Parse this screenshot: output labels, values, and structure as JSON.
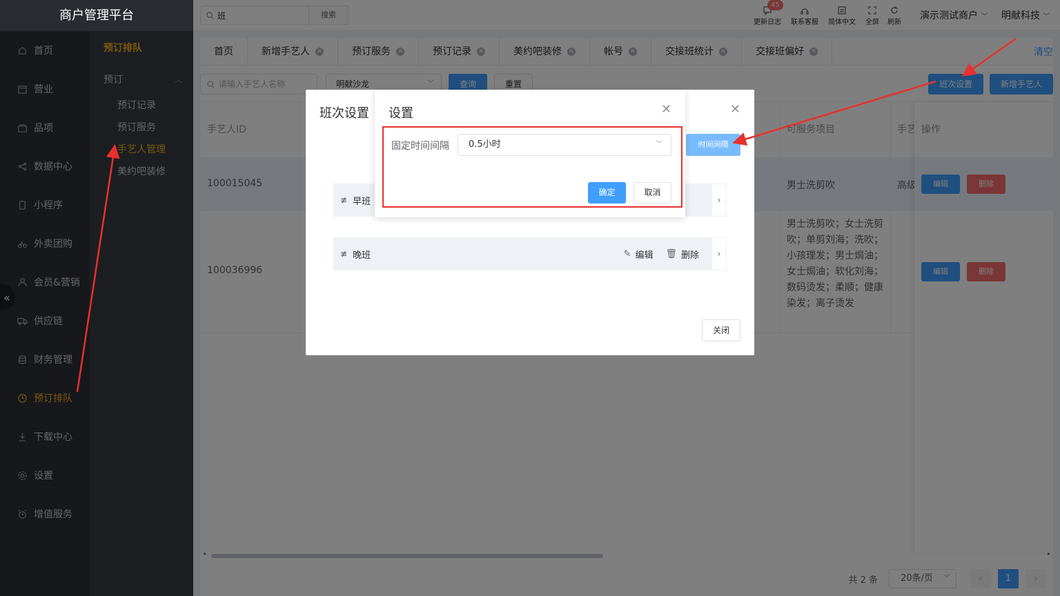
{
  "app": {
    "title": "商户管理平台"
  },
  "topbar": {
    "search_value": "班",
    "search_button": "搜索",
    "tools": [
      {
        "label": "更新日志",
        "icon": "message-icon",
        "badge": "45"
      },
      {
        "label": "联系客服",
        "icon": "headset-icon"
      },
      {
        "label": "简体中文",
        "icon": "language-icon"
      },
      {
        "label": "全屏",
        "icon": "fullscreen-icon"
      },
      {
        "label": "刷新",
        "icon": "refresh-icon"
      }
    ],
    "merchant": "演示测试商户",
    "company": "明献科技"
  },
  "sidebar": {
    "items": [
      {
        "label": "首页",
        "icon": "home-icon"
      },
      {
        "label": "营业",
        "icon": "calendar-icon"
      },
      {
        "label": "品项",
        "icon": "bag-icon"
      },
      {
        "label": "数据中心",
        "icon": "share-icon"
      },
      {
        "label": "小程序",
        "icon": "phone-icon"
      },
      {
        "label": "外卖团购",
        "icon": "bike-icon"
      },
      {
        "label": "会员&营销",
        "icon": "user-icon"
      },
      {
        "label": "供应链",
        "icon": "truck-icon"
      },
      {
        "label": "财务管理",
        "icon": "database-icon"
      },
      {
        "label": "预订排队",
        "icon": "clock-icon",
        "active": true
      },
      {
        "label": "下载中心",
        "icon": "download-icon"
      },
      {
        "label": "设置",
        "icon": "settings-icon"
      },
      {
        "label": "增值服务",
        "icon": "alarm-icon"
      }
    ],
    "collapse_glyph": "«"
  },
  "subnav": {
    "title": "预订排队",
    "group": "预订",
    "items": [
      "预订记录",
      "预订服务",
      "手艺人管理",
      "美约吧装修"
    ],
    "active_index": 2
  },
  "tabs": {
    "items": [
      "首页",
      "新增手艺人",
      "预订服务",
      "预订记录",
      "美约吧装修",
      "帐号",
      "交接班统计",
      "交接班偏好"
    ],
    "clear_label": "清空"
  },
  "filter": {
    "name_placeholder": "请输入手艺人名称",
    "store_value": "明献沙龙",
    "query_label": "查询",
    "reset_label": "重置",
    "shift_settings_label": "班次设置",
    "add_artisan_label": "新增手艺人"
  },
  "table": {
    "headers": {
      "id": "手艺人ID",
      "services": "可服务项目",
      "level": "手艺",
      "ops": "操作"
    },
    "rows": [
      {
        "id": "100015045",
        "services": "男士洗剪吹",
        "level": "高级"
      },
      {
        "id": "100036996",
        "services": "男士洗剪吹；女士洗剪吹；单剪刘海；洗吹；小孩理发；男士焗油；女士焗油；软化刘海；数码烫发；柔顺；健康染发；离子烫发",
        "level": ""
      }
    ],
    "edit_label": "编辑",
    "delete_label": "删除"
  },
  "pagination": {
    "total": "共 2 条",
    "page_size": "20条/页",
    "current_page": "1",
    "prev": "‹",
    "next": "›"
  },
  "shift_dialog": {
    "title": "班次设置",
    "interval_button": "时间间隔",
    "shifts": [
      {
        "name": "早班"
      },
      {
        "name": "晚班",
        "edit": "编辑",
        "delete": "删除"
      }
    ],
    "close_label": "关闭"
  },
  "settings_dialog": {
    "title": "设置",
    "field_label": "固定时间间隔",
    "field_value": "0.5小时",
    "confirm_label": "确定",
    "cancel_label": "取消"
  },
  "colors": {
    "primary": "#409eff",
    "danger": "#f56c6c",
    "active_nav": "#f0b323",
    "annotation": "#e8312e"
  }
}
